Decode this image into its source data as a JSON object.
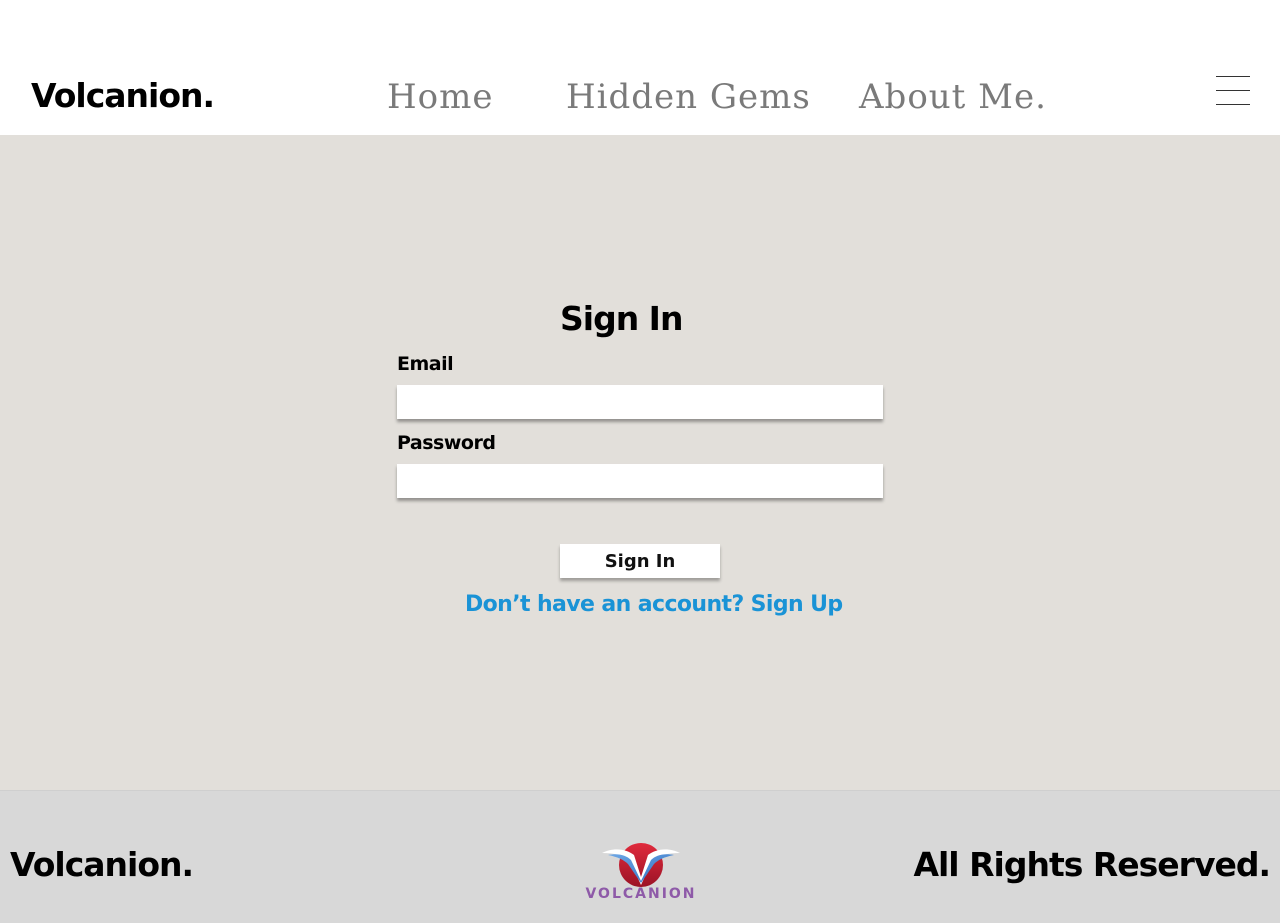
{
  "header": {
    "brand": "Volcanion.",
    "nav": {
      "home": "Home",
      "hidden_gems": "Hidden Gems",
      "about": "About Me."
    },
    "menu_icon": "hamburger-menu-icon"
  },
  "form": {
    "title": "Sign In",
    "email_label": "Email",
    "email_value": "",
    "password_label": "Password",
    "password_value": "",
    "submit_label": "Sign In",
    "signup_text": "Don’t have an account? Sign Up"
  },
  "footer": {
    "brand": "Volcanion.",
    "logo_text": "VOLCANION",
    "rights": "All Rights Reserved."
  },
  "colors": {
    "main_background": "#e2dfda",
    "footer_background": "#d8d8d8",
    "nav_text": "#7a7a7a",
    "link_accent": "#1a93d6",
    "logo_red": "#d4253a",
    "logo_purple": "#8e5aa8"
  }
}
